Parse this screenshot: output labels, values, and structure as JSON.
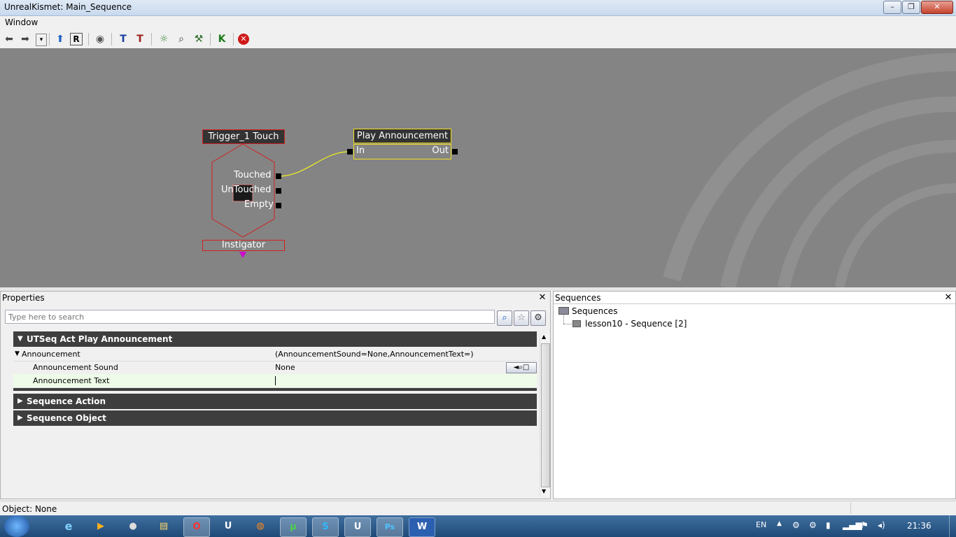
{
  "window": {
    "title": "UnrealKismet: Main_Sequence",
    "minimize": "–",
    "maximize": "❐",
    "close": "✕"
  },
  "menu": {
    "window": "Window"
  },
  "toolbar": {
    "icons": [
      "back-arrow-icon",
      "forward-arrow-icon",
      "dropdown-icon",
      "up-arrow-icon",
      "refresh-r-icon",
      "eye-icon",
      "create-sequence-icon",
      "create-sequence-alt-icon",
      "light-bulb-icon",
      "search-magnifier-icon",
      "wrench-icon",
      "k-icon",
      "stop-icon"
    ]
  },
  "canvas": {
    "trigger_node": {
      "title": "Trigger_1 Touch",
      "outputs": [
        "Touched",
        "UnTouched",
        "Empty"
      ],
      "variable": "Instigator"
    },
    "action_node": {
      "title": "Play Announcement",
      "input": "In",
      "output": "Out"
    },
    "colors": {
      "trigger_border": "#d22020",
      "action_border": "#f0e020",
      "link": "#f0f020",
      "instigator_pin": "#d000d0"
    }
  },
  "properties": {
    "header": "Properties",
    "search_placeholder": "Type here to search",
    "categories": {
      "main": "UTSeq Act Play Announcement",
      "sequence_action": "Sequence Action",
      "sequence_object": "Sequence Object"
    },
    "rows": {
      "announcement": {
        "name": "Announcement",
        "value": "(AnnouncementSound=None,AnnouncementText=)"
      },
      "announcement_sound": {
        "name": "Announcement Sound",
        "value": "None"
      },
      "announcement_text": {
        "name": "Announcement Text",
        "value": ""
      }
    }
  },
  "sequences": {
    "header": "Sequences",
    "root": "Sequences",
    "child": "lesson10 - Sequence [2]"
  },
  "status": {
    "text": "Object: None"
  },
  "taskbar": {
    "lang": "EN",
    "clock": "21:36",
    "apps": [
      "Opera",
      "Unreal",
      "Firefox",
      "uTorrent",
      "Skype",
      "Unreal Editor",
      "Photoshop",
      "Word"
    ],
    "ps_label": "Ps",
    "word_label": "W",
    "u_label": "U"
  }
}
